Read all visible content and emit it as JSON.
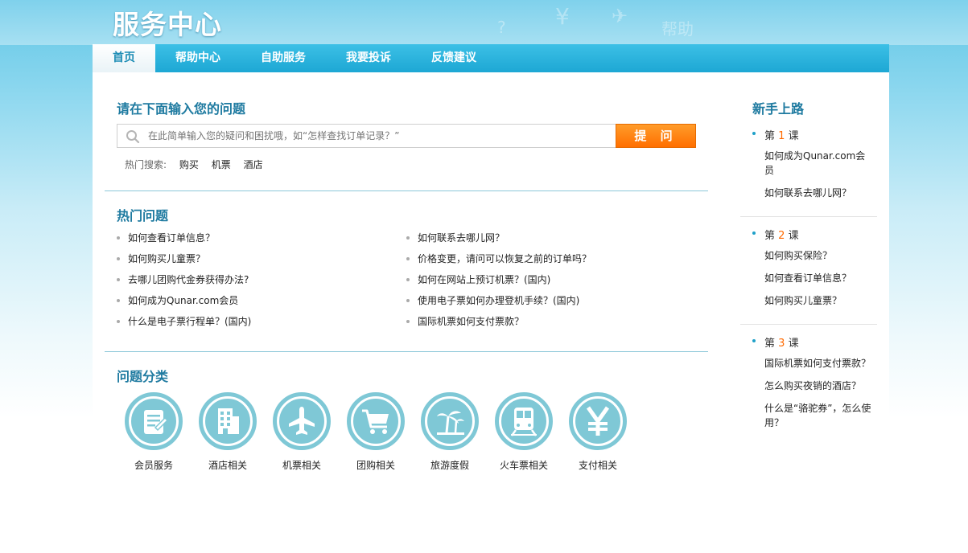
{
  "header": {
    "title": "服务中心",
    "deco": [
      "¥",
      "帮助",
      "?",
      "✈"
    ]
  },
  "nav": {
    "tabs": [
      "首页",
      "帮助中心",
      "自助服务",
      "我要投诉",
      "反馈建议"
    ],
    "active_index": 0
  },
  "ask": {
    "title": "请在下面输入您的问题",
    "placeholder": "在此简单输入您的疑问和困扰哦，如“怎样查找订单记录？”",
    "button_label": "提 问",
    "hot_search_label": "热门搜索:",
    "hot_search_items": [
      "购买",
      "机票",
      "酒店"
    ]
  },
  "hot_questions": {
    "title": "热门问题",
    "left": [
      "如何查看订单信息？",
      "如何购买儿童票？",
      "去哪儿团购代金券获得办法?",
      "如何成为Qunar.com会员",
      "什么是电子票行程单？(国内)"
    ],
    "right": [
      "如何联系去哪儿网？",
      "价格变更，请问可以恢复之前的订单吗？",
      "如何在网站上预订机票？(国内)",
      "使用电子票如何办理登机手续？(国内)",
      "国际机票如何支付票款？"
    ]
  },
  "categories": {
    "title": "问题分类",
    "items": [
      {
        "label": "会员服务",
        "icon": "member-icon"
      },
      {
        "label": "酒店相关",
        "icon": "hotel-icon"
      },
      {
        "label": "机票相关",
        "icon": "airplane-icon"
      },
      {
        "label": "团购相关",
        "icon": "shopping-cart-icon"
      },
      {
        "label": "旅游度假",
        "icon": "palm-tree-icon"
      },
      {
        "label": "火车票相关",
        "icon": "train-icon"
      },
      {
        "label": "支付相关",
        "icon": "yen-icon"
      }
    ]
  },
  "sidebar": {
    "title": "新手上路",
    "lessons": [
      {
        "prefix": "第",
        "num": "1",
        "suffix": "课",
        "links": [
          "如何成为Qunar.com会员",
          "如何联系去哪儿网？"
        ]
      },
      {
        "prefix": "第",
        "num": "2",
        "suffix": "课",
        "links": [
          "如何购买保险？",
          "如何查看订单信息？",
          "如何购买儿童票？"
        ]
      },
      {
        "prefix": "第",
        "num": "3",
        "suffix": "课",
        "links": [
          "国际机票如何支付票款？",
          "怎么购买夜销的酒店？",
          "什么是“骆驼券”，怎么使用？"
        ]
      }
    ]
  },
  "colors": {
    "accent": "#1e7aa0",
    "nav_bg": "#1da7d4",
    "button": "#ff7a00",
    "icon_circle": "#7fc8d6",
    "lesson_number": "#ff6a00"
  }
}
